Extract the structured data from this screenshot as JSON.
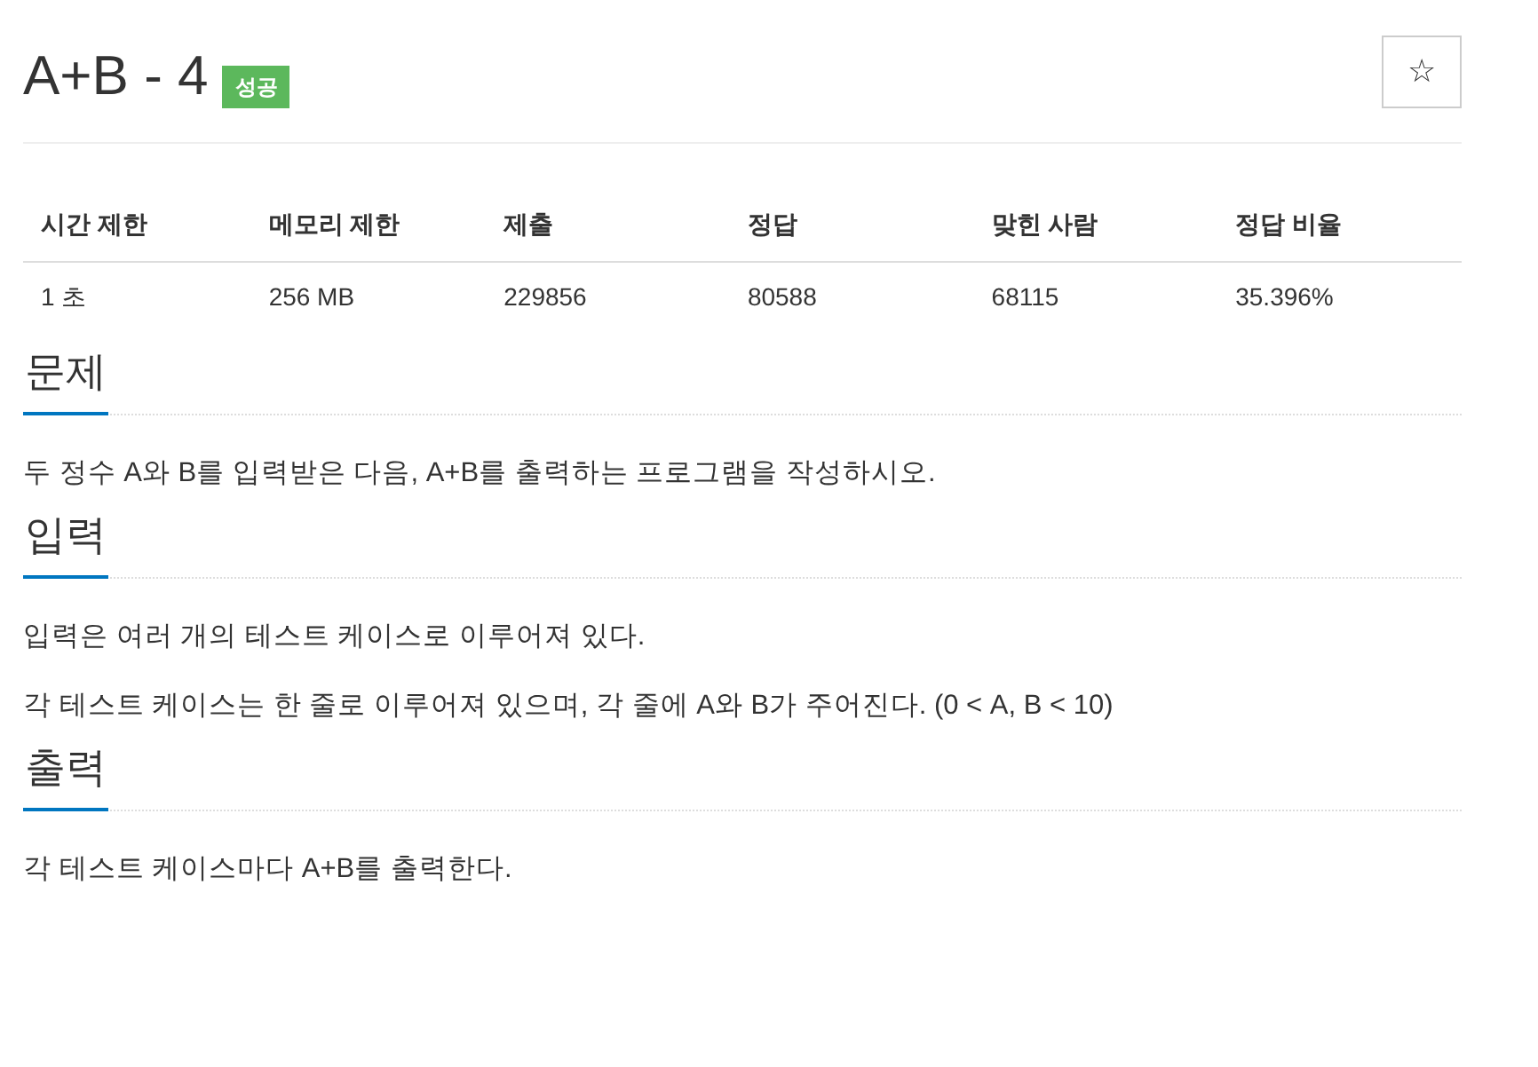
{
  "problem": {
    "title": "A+B - 4",
    "badge": "성공",
    "star_button": "☆"
  },
  "stats_table": {
    "columns": [
      "시간 제한",
      "메모리 제한",
      "제출",
      "정답",
      "맞힌 사람",
      "정답 비율"
    ],
    "rows": [
      [
        "1 초",
        "256 MB",
        "229856",
        "80588",
        "68115",
        "35.396%"
      ]
    ]
  },
  "sections": [
    {
      "heading": "문제",
      "paragraphs": [
        "두 정수 A와 B를 입력받은 다음, A+B를 출력하는 프로그램을 작성하시오."
      ]
    },
    {
      "heading": "입력",
      "paragraphs": [
        "입력은 여러 개의 테스트 케이스로 이루어져 있다.",
        "각 테스트 케이스는 한 줄로 이루어져 있으며, 각 줄에 A와 B가 주어진다. (0 < A, B < 10)"
      ]
    },
    {
      "heading": "출력",
      "paragraphs": [
        "각 테스트 케이스마다 A+B를 출력한다."
      ]
    }
  ]
}
